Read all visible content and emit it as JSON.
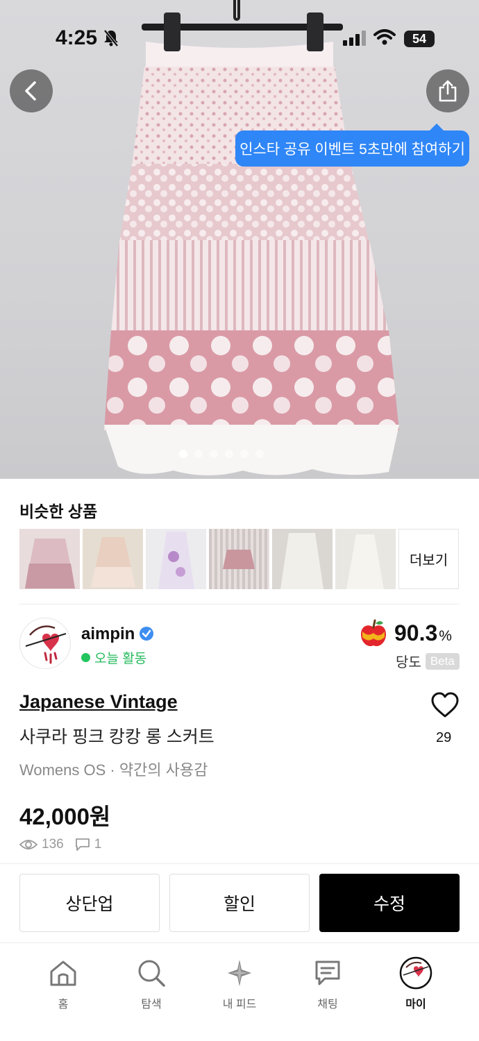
{
  "status_bar": {
    "time": "4:25",
    "battery": "54"
  },
  "hero": {
    "share_tooltip": "인스타 공유 이벤트 5초만에 참여하기",
    "page_count": 6,
    "active_page": 1
  },
  "similar": {
    "title": "비슷한 상품",
    "more_label": "더보기",
    "items": [
      {
        "name": "similar-item-1",
        "bg": "#e8dcdc"
      },
      {
        "name": "similar-item-2",
        "bg": "#e6ddd2"
      },
      {
        "name": "similar-item-3",
        "bg": "#e9e6ea"
      },
      {
        "name": "similar-item-4",
        "bg": "#d7cfcf"
      },
      {
        "name": "similar-item-5",
        "bg": "#dfdcd8"
      },
      {
        "name": "similar-item-6",
        "bg": "#e9e7e2"
      }
    ]
  },
  "seller": {
    "name": "aimpin",
    "activity": "오늘 활동",
    "score": "90.3",
    "score_unit": "%",
    "sugar_label": "당도",
    "beta_label": "Beta"
  },
  "product": {
    "brand": "Japanese Vintage",
    "title": "사쿠라 핑크 캉캉 롱 스커트",
    "meta": "Womens OS · 약간의 사용감",
    "price": "42,000원",
    "likes": "29",
    "views": "136",
    "comments": "1"
  },
  "actions": {
    "bump": "상단업",
    "discount": "할인",
    "edit": "수정"
  },
  "nav": {
    "home": "홈",
    "search": "탐색",
    "feed": "내 피드",
    "chat": "채팅",
    "my": "마이"
  },
  "colors": {
    "accent_blue": "#2f86f6",
    "active_green": "#22b95a",
    "primary_black": "#000000"
  }
}
